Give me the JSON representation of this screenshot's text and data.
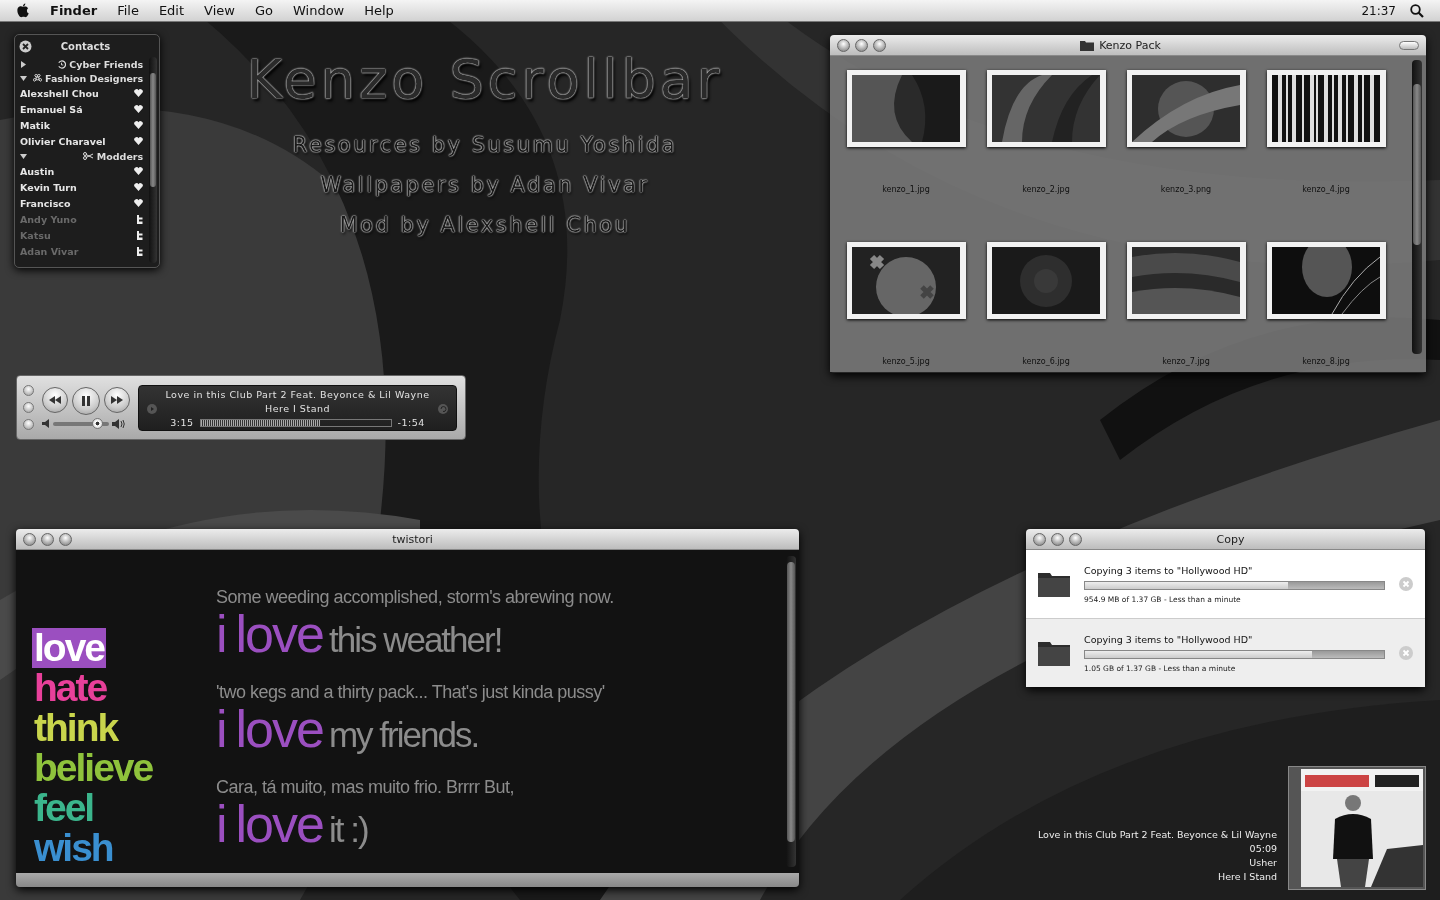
{
  "menu_bar": {
    "items": [
      {
        "label": "Finder",
        "kind": "app"
      },
      {
        "label": "File",
        "kind": "menu"
      },
      {
        "label": "Edit",
        "kind": "menu"
      },
      {
        "label": "View",
        "kind": "menu"
      },
      {
        "label": "Go",
        "kind": "menu"
      },
      {
        "label": "Window",
        "kind": "menu"
      },
      {
        "label": "Help",
        "kind": "menu"
      }
    ],
    "clock": "21:37"
  },
  "contacts": {
    "title": "Contacts",
    "groups": [
      {
        "name": "Cyber Friends",
        "expanded": false
      },
      {
        "name": "Fashion Designers",
        "expanded": true,
        "children": [
          {
            "name": "Alexshell Chou",
            "online": true,
            "kind": "heart"
          },
          {
            "name": "Emanuel Sá",
            "online": true,
            "kind": "heart"
          },
          {
            "name": "Matik",
            "online": true,
            "kind": "heart"
          },
          {
            "name": "Olivier Charavel",
            "online": true,
            "kind": "heart"
          }
        ]
      },
      {
        "name": "Modders",
        "expanded": true,
        "children": [
          {
            "name": "Austin",
            "online": true,
            "kind": "heart"
          },
          {
            "name": "Kevin Turn",
            "online": true,
            "kind": "heart"
          },
          {
            "name": "Francisco",
            "online": true,
            "kind": "heart"
          },
          {
            "name": "Andy Yuno",
            "online": false,
            "kind": "twitter"
          },
          {
            "name": "Katsu",
            "online": false,
            "kind": "twitter"
          },
          {
            "name": "Adan Vivar",
            "online": false,
            "kind": "twitter"
          }
        ]
      }
    ]
  },
  "headline": {
    "title": "Kenzo Scrollbar",
    "credits": [
      "Resources by Susumu Yoshida",
      "Wallpapers by Adan Vivar",
      "Mod by Alexshell Chou"
    ]
  },
  "kenzo_pack": {
    "title": "Kenzo Pack",
    "files": [
      {
        "name": "kenzo_1.jpg",
        "kind": "picture"
      },
      {
        "name": "kenzo_2.jpg",
        "kind": "picture"
      },
      {
        "name": "kenzo_3.png",
        "kind": "picture"
      },
      {
        "name": "kenzo_4.jpg",
        "kind": "picture"
      },
      {
        "name": "kenzo_5.jpg",
        "kind": "picture"
      },
      {
        "name": "kenzo_6.jpg",
        "kind": "picture"
      },
      {
        "name": "kenzo_7.jpg",
        "kind": "picture"
      },
      {
        "name": "kenzo_8.jpg",
        "kind": "picture"
      }
    ]
  },
  "player": {
    "track": "Love in this Club Part 2 Feat. Beyonce & Lil Wayne",
    "album": "Here I Stand",
    "elapsed": "3:15",
    "remaining": "-1:54",
    "progress": {
      "level": 0.63
    },
    "volume": {
      "level": 0.78
    }
  },
  "twistori": {
    "title": "twistori",
    "words": [
      {
        "text": "love",
        "color": "#9b4fc0",
        "selected": true
      },
      {
        "text": "hate",
        "color": "#e8409a",
        "selected": false
      },
      {
        "text": "think",
        "color": "#c9d54c",
        "selected": false
      },
      {
        "text": "believe",
        "color": "#8fc33c",
        "selected": false
      },
      {
        "text": "feel",
        "color": "#3bb58c",
        "selected": false
      },
      {
        "text": "wish",
        "color": "#3a8fd0",
        "selected": false
      }
    ],
    "entries": [
      {
        "quote": "Some weeding accomplished, storm's abrewing now.",
        "lead": "i",
        "verb": "love",
        "rest": "this weather!"
      },
      {
        "quote": "'two kegs and a thirty pack... That's just kinda pussy'",
        "lead": "i",
        "verb": "love",
        "rest": "my friends."
      },
      {
        "quote": "Cara, tá muito, mas muito frio. Brrrr But,",
        "lead": "i",
        "verb": "love",
        "rest": "it :)"
      }
    ]
  },
  "copy": {
    "title": "Copy",
    "items": [
      {
        "title": "Copying 3 items to \"Hollywood HD\"",
        "status": "954.9 MB of 1.37 GB - Less than a minute",
        "level": 0.68
      },
      {
        "title": "Copying 3 items to \"Hollywood HD\"",
        "status": "1.05 GB of 1.37 GB - Less than a minute",
        "level": 0.76
      }
    ]
  },
  "now_playing": {
    "track": "Love in this Club Part 2 Feat. Beyonce & Lil Wayne",
    "duration": "05:09",
    "artist": "Usher",
    "album": "Here I Stand"
  }
}
